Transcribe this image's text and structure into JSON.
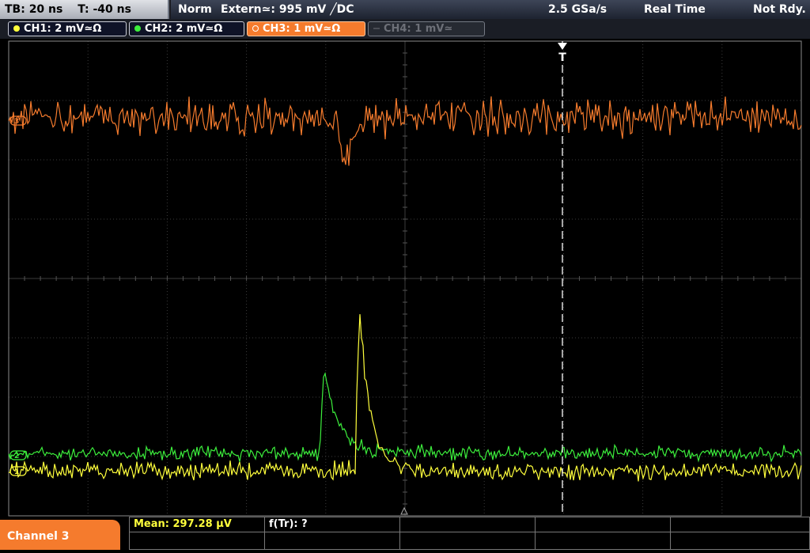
{
  "timebase": {
    "tb": "TB: 20 ns",
    "trigger_time": "T: -40 ns"
  },
  "trigger_info": {
    "mode": "Norm",
    "source_level": "Extern≃: 995 mV ╱DC",
    "sample_rate": "2.5 GSa/s",
    "acq_mode": "Real Time",
    "status": "Not Rdy."
  },
  "channels": [
    {
      "label": "CH1: 2 mV≃Ω",
      "color": "#ffff3c",
      "active": true
    },
    {
      "label": "CH2: 2 mV≃Ω",
      "color": "#3cee3c",
      "active": true
    },
    {
      "label": "CH3: 1 mV≃Ω",
      "color": "#f57b2d",
      "active": true,
      "selected": true
    },
    {
      "label": "CH4: 1 mV≃",
      "color": "#6d7078",
      "active": false
    }
  ],
  "waveform_markers": {
    "ch3": "3",
    "ch2": "2",
    "ch1": "1",
    "trigger": "T"
  },
  "colors": {
    "ch1": "#ffff3c",
    "ch2": "#3cee3c",
    "ch3": "#f57b2d",
    "grid": "#3b3b3b",
    "accent": "#f57b2d"
  },
  "bottom": {
    "channel_label": "Channel 3",
    "measurement_1": "Mean: 297.28 µV",
    "measurement_2": "f(Tr): ?"
  }
}
